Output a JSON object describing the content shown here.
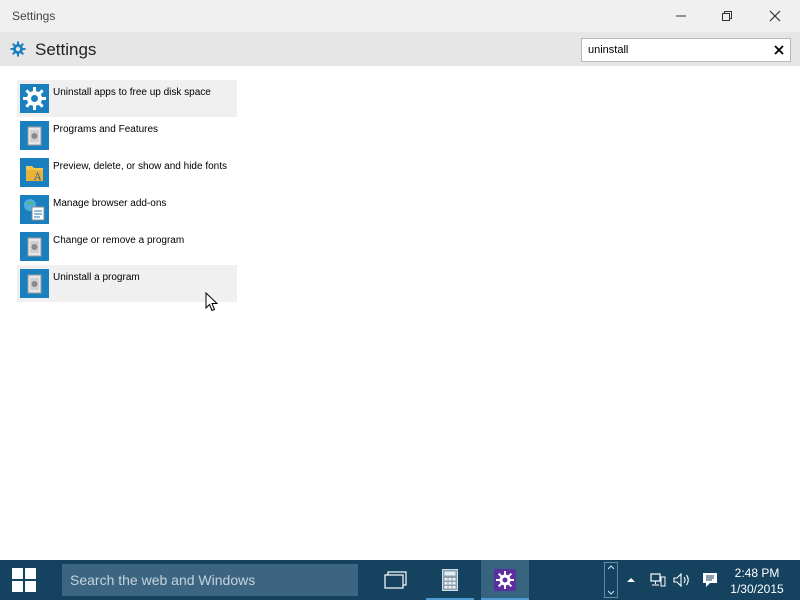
{
  "window": {
    "title": "Settings"
  },
  "header": {
    "title": "Settings"
  },
  "search": {
    "value": "uninstall"
  },
  "results": [
    {
      "label": "Uninstall apps to free up disk space",
      "icon": "gear-icon"
    },
    {
      "label": "Programs and Features",
      "icon": "programs-icon"
    },
    {
      "label": "Preview, delete, or show and hide fonts",
      "icon": "fonts-folder-icon"
    },
    {
      "label": "Manage browser add-ons",
      "icon": "internet-options-icon"
    },
    {
      "label": "Change or remove a program",
      "icon": "programs-icon"
    },
    {
      "label": "Uninstall a program",
      "icon": "programs-icon"
    }
  ],
  "taskbar": {
    "search_placeholder": "Search the web and Windows",
    "time": "2:48 PM",
    "date": "1/30/2015"
  },
  "colors": {
    "accent": "#1a7fbf",
    "taskbar": "#15425f",
    "taskbar_search": "#3c6581",
    "settings_tile": "#5b2fa0"
  }
}
